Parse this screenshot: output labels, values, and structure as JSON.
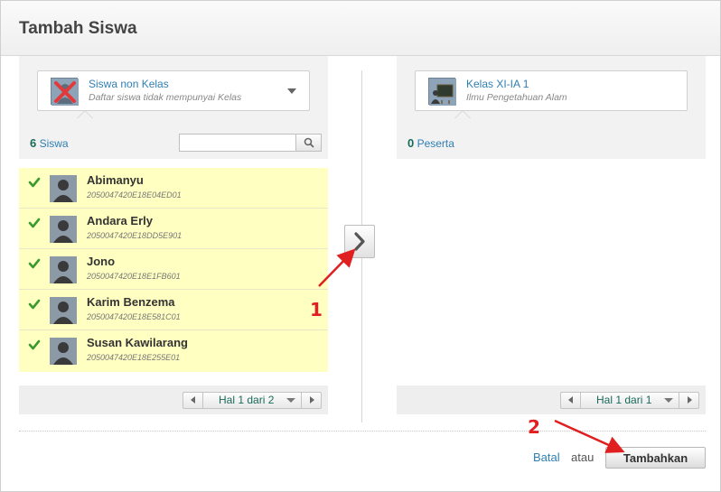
{
  "dialog": {
    "title": "Tambah Siswa"
  },
  "left_panel": {
    "selector": {
      "name": "Siswa non Kelas",
      "description": "Daftar siswa tidak mempunyai Kelas",
      "icon": "no-class-icon"
    },
    "count_number": "6",
    "count_label": "Siswa",
    "search": {
      "value": "",
      "placeholder": ""
    },
    "students": [
      {
        "name": "Abimanyu",
        "id": "2050047420E18E04ED01",
        "checked": true
      },
      {
        "name": "Andara Erly",
        "id": "2050047420E18DD5E901",
        "checked": true
      },
      {
        "name": "Jono",
        "id": "2050047420E18E1FB601",
        "checked": true
      },
      {
        "name": "Karim Benzema",
        "id": "2050047420E18E581C01",
        "checked": true
      },
      {
        "name": "Susan Kawilarang",
        "id": "2050047420E18E255E01",
        "checked": true
      }
    ],
    "pager": {
      "label": "Hal 1 dari 2"
    }
  },
  "right_panel": {
    "selector": {
      "name": "Kelas XI-IA 1",
      "description": "Ilmu Pengetahuan Alam",
      "icon": "classroom-icon"
    },
    "count_number": "0",
    "count_label": "Peserta",
    "pager": {
      "label": "Hal 1 dari 1"
    }
  },
  "footer": {
    "cancel_label": "Batal",
    "or_label": "atau",
    "submit_label": "Tambahkan"
  },
  "annotations": {
    "step1": "1",
    "step2": "2"
  },
  "colors": {
    "accent": "#2f7fb3",
    "highlight": "#ffffc2",
    "annotation": "#e02020"
  }
}
